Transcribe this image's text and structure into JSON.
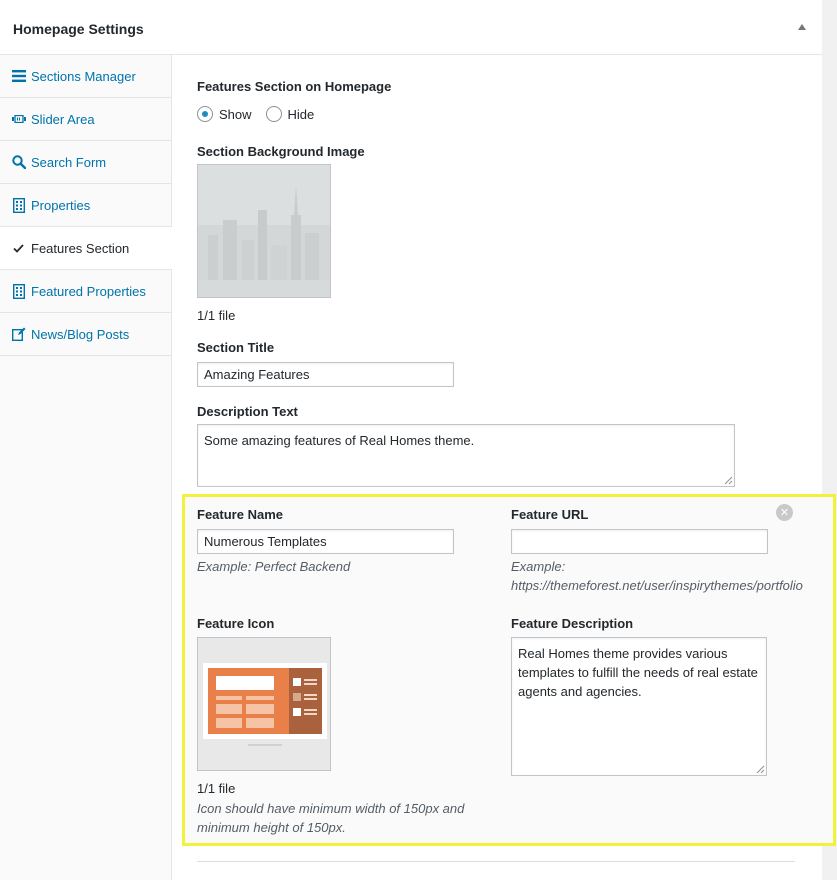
{
  "panel": {
    "title": "Homepage Settings"
  },
  "sidebar": {
    "items": [
      {
        "label": "Sections Manager",
        "icon": "menu-icon"
      },
      {
        "label": "Slider Area",
        "icon": "slides-icon"
      },
      {
        "label": "Search Form",
        "icon": "search-icon"
      },
      {
        "label": "Properties",
        "icon": "building-icon"
      },
      {
        "label": "Features Section",
        "icon": "check-icon",
        "active": true
      },
      {
        "label": "Featured Properties",
        "icon": "building-icon"
      },
      {
        "label": "News/Blog Posts",
        "icon": "edit-icon"
      }
    ]
  },
  "features_section": {
    "visibility_label": "Features Section on Homepage",
    "show_label": "Show",
    "hide_label": "Hide",
    "selected": "Show",
    "bg_image_label": "Section Background Image",
    "bg_file_count": "1/1 file",
    "title_label": "Section Title",
    "title_value": "Amazing Features",
    "description_label": "Description Text",
    "description_value": "Some amazing features of Real Homes theme."
  },
  "feature_item": {
    "name_label": "Feature Name",
    "name_value": "Numerous Templates",
    "name_hint": "Example: Perfect Backend",
    "url_label": "Feature URL",
    "url_value": "",
    "url_hint_line1": "Example:",
    "url_hint_line2": "https://themeforest.net/user/inspirythemes/portfolio",
    "icon_label": "Feature Icon",
    "icon_file_count": "1/1 file",
    "icon_hint_line1": "Icon should have minimum width of 150px and",
    "icon_hint_line2": "minimum height of 150px.",
    "description_label": "Feature Description",
    "description_value": "Real Homes theme provides various templates to fulfill the needs of real estate agents and agencies."
  },
  "colors": {
    "link": "#0073aa",
    "highlight": "#f2f23a",
    "radio_accent": "#1e8cbe"
  }
}
